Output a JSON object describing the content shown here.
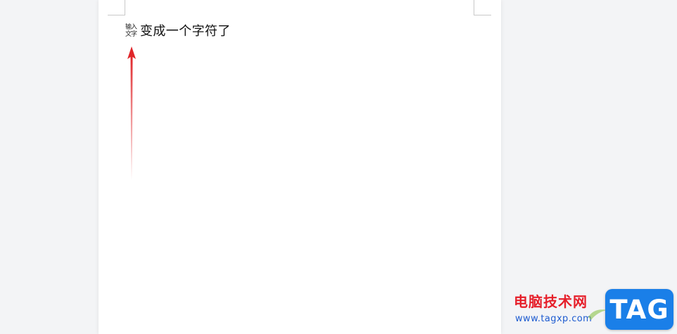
{
  "document": {
    "combined_chars": {
      "top": "输入",
      "bottom": "文字"
    },
    "text": "变成一个字符了"
  },
  "annotation": {
    "arrow_color": "#e0262a"
  },
  "watermark": {
    "site_name": "电脑技术网",
    "url": "www.tagxp.com",
    "logo_text": "TAG",
    "colors": {
      "site_name": "#e61f2a",
      "url": "#1d5bd0",
      "logo_bg": "#1a7fe8"
    }
  }
}
